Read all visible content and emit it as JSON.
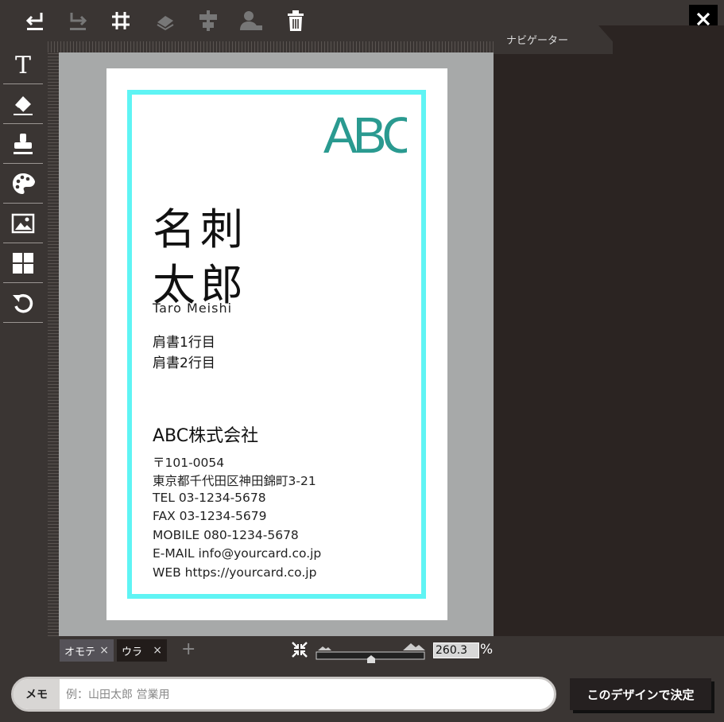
{
  "navigator": {
    "title": "ナビゲーター"
  },
  "card": {
    "logo_text": "ABC",
    "name_line1": "名刺",
    "name_line2": "太郎",
    "name_roman": "Taro Meishi",
    "title_line1": "肩書1行目",
    "title_line2": "肩書2行目",
    "company": "ABC株式会社",
    "info": [
      "〒101-0054",
      "東京都千代田区神田錦町3-21",
      "TEL 03-1234-5678",
      "FAX 03-1234-5679",
      "MOBILE 080-1234-5678",
      "E-MAIL info@yourcard.co.jp",
      "WEB https://yourcard.co.jp"
    ],
    "frame_color": "#5ff4f4",
    "logo_color": "#2a9a90"
  },
  "tabs": [
    {
      "label": "オモテ",
      "close": "×"
    },
    {
      "label": "ウラ",
      "close": "×"
    }
  ],
  "add_tab": "+",
  "zoom": {
    "value": "260.3",
    "unit": "%"
  },
  "memo": {
    "label": "メモ",
    "placeholder": "例：山田太郎 営業用"
  },
  "decide_button": "このデザインで決定",
  "close_button": "✕",
  "toolbar_icons": [
    "undo-icon",
    "redo-icon",
    "grid-icon",
    "eraser-layer-icon",
    "align-icon",
    "person-icon",
    "trash-icon"
  ],
  "left_tool_icons": [
    "text-icon",
    "eraser-icon",
    "stamp-icon",
    "palette-icon",
    "image-icon",
    "layout-icon",
    "reset-icon"
  ]
}
